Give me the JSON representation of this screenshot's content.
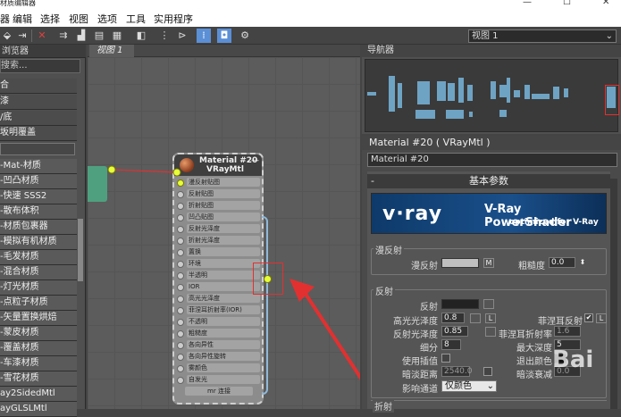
{
  "titlebar": {
    "title": "材质编辑器",
    "minimize": "—",
    "maximize": "☐",
    "close": "✕"
  },
  "menu": [
    "编辑",
    "选择",
    "视图",
    "选项",
    "工具",
    "实用程序"
  ],
  "menu_partial_first": "器",
  "toolbar": {
    "view_select": "视图 1"
  },
  "browser": {
    "header": "浏览器",
    "search": "搜索...",
    "items": [
      "合",
      "漆",
      "/底",
      "坂明覆盖",
      "",
      "-Mat-材质",
      "-凹凸材质",
      "-快速 SSS2",
      "-散布体积",
      "-材质包裹器",
      "-模拟有机材质",
      "-毛发材质",
      "-混合材质",
      "-灯光材质",
      "-点粒子材质",
      "-矢量置换烘焙",
      "-蒙皮材质",
      "-覆盖材质",
      "-车漆材质",
      "-雪花材质",
      "ay2SidedMtl",
      "ayGLSLMtl"
    ]
  },
  "viewport": {
    "tab": "视图 1"
  },
  "node": {
    "title1": "Material #20",
    "title2": "VRayMtl",
    "min": "—",
    "slots": [
      "漫反射贴图",
      "反射贴图",
      "折射贴图",
      "凹凸贴图",
      "反射光泽度",
      "折射光泽度",
      "置换",
      "环境",
      "半透明",
      "IOR",
      "高光光泽度",
      "菲涅耳折射率(IOR)",
      "不透明",
      "粗糙度",
      "各向异性",
      "各向异性旋转",
      "雾颜色",
      "自发光"
    ],
    "footer": "mr 连接"
  },
  "navigator": {
    "header": "导航器"
  },
  "props": {
    "header": "Material #20 ( VRayMtl )",
    "name": "Material #20",
    "rollout": "基本参数",
    "rollout_mark": "-",
    "banner": {
      "logo": "v·ray",
      "title": "V-Ray PowerShader",
      "sub": "optimized for V-Ray"
    },
    "diffuse": {
      "group": "漫反射",
      "label": "漫反射",
      "m": "M",
      "rough_label": "粗糙度",
      "rough": "0.0"
    },
    "reflect": {
      "group": "反射",
      "label": "反射",
      "hilight_label": "高光光泽度",
      "hilight": "0.8",
      "l1": "L",
      "fresnel_label": "菲涅耳反射",
      "fresnel_check": "✔",
      "l2": "L",
      "gloss_label": "反射光泽度",
      "gloss": "0.85",
      "fresnel_ior_label": "菲涅耳折射率",
      "fresnel_ior": "1.6",
      "subdiv_label": "细分",
      "subdiv": "8",
      "maxdepth_label": "最大深度",
      "maxdepth": "5",
      "interp_label": "使用插值",
      "exitcolor_label": "退出颜色",
      "dimdist_label": "暗淡距离",
      "dimdist": "2540.0",
      "dimfall_label": "暗淡衰减",
      "dimfall": "0.0",
      "affect_label": "影响通道",
      "affect": "仅颜色"
    },
    "refract": {
      "group": "折射"
    }
  },
  "watermark": "Bai"
}
